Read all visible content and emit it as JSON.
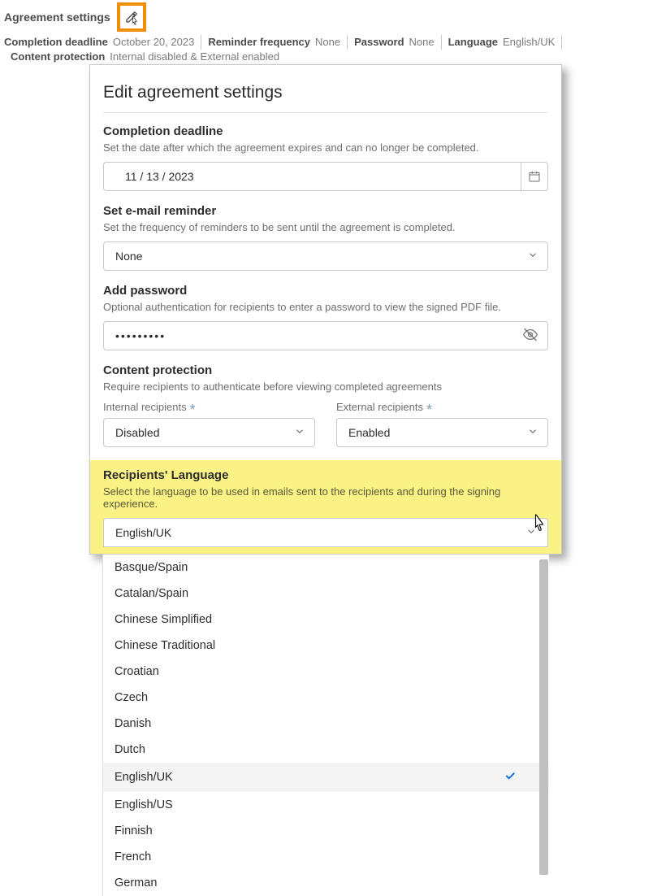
{
  "header": {
    "title": "Agreement settings",
    "summary": [
      {
        "label": "Completion deadline",
        "value": "October 20, 2023"
      },
      {
        "label": "Reminder frequency",
        "value": "None"
      },
      {
        "label": "Password",
        "value": "None"
      },
      {
        "label": "Language",
        "value": "English/UK"
      },
      {
        "label": "Content protection",
        "value": "Internal disabled & External enabled"
      }
    ]
  },
  "dialog": {
    "title": "Edit agreement settings",
    "deadline": {
      "title": "Completion deadline",
      "desc": "Set the date after which the agreement expires and can no longer be completed.",
      "value": "11 /  13 /  2023"
    },
    "reminder": {
      "title": "Set e-mail reminder",
      "desc": "Set the frequency of reminders to be sent until the agreement is completed.",
      "value": "None"
    },
    "password": {
      "title": "Add password",
      "desc": "Optional authentication for recipients to enter a password to view the signed PDF file.",
      "value": "•••••••••"
    },
    "protection": {
      "title": "Content protection",
      "desc": "Require recipients to authenticate before viewing completed agreements",
      "internal_label": "Internal recipients",
      "internal_value": "Disabled",
      "external_label": "External recipients",
      "external_value": "Enabled"
    },
    "language": {
      "title": "Recipients' Language",
      "desc": "Select the language to be used in emails sent to the recipients and during the signing experience.",
      "selected": "English/UK",
      "options": [
        "Basque/Spain",
        "Catalan/Spain",
        "Chinese Simplified",
        "Chinese Traditional",
        "Croatian",
        "Czech",
        "Danish",
        "Dutch",
        "English/UK",
        "English/US",
        "Finnish",
        "French",
        "German"
      ]
    }
  }
}
